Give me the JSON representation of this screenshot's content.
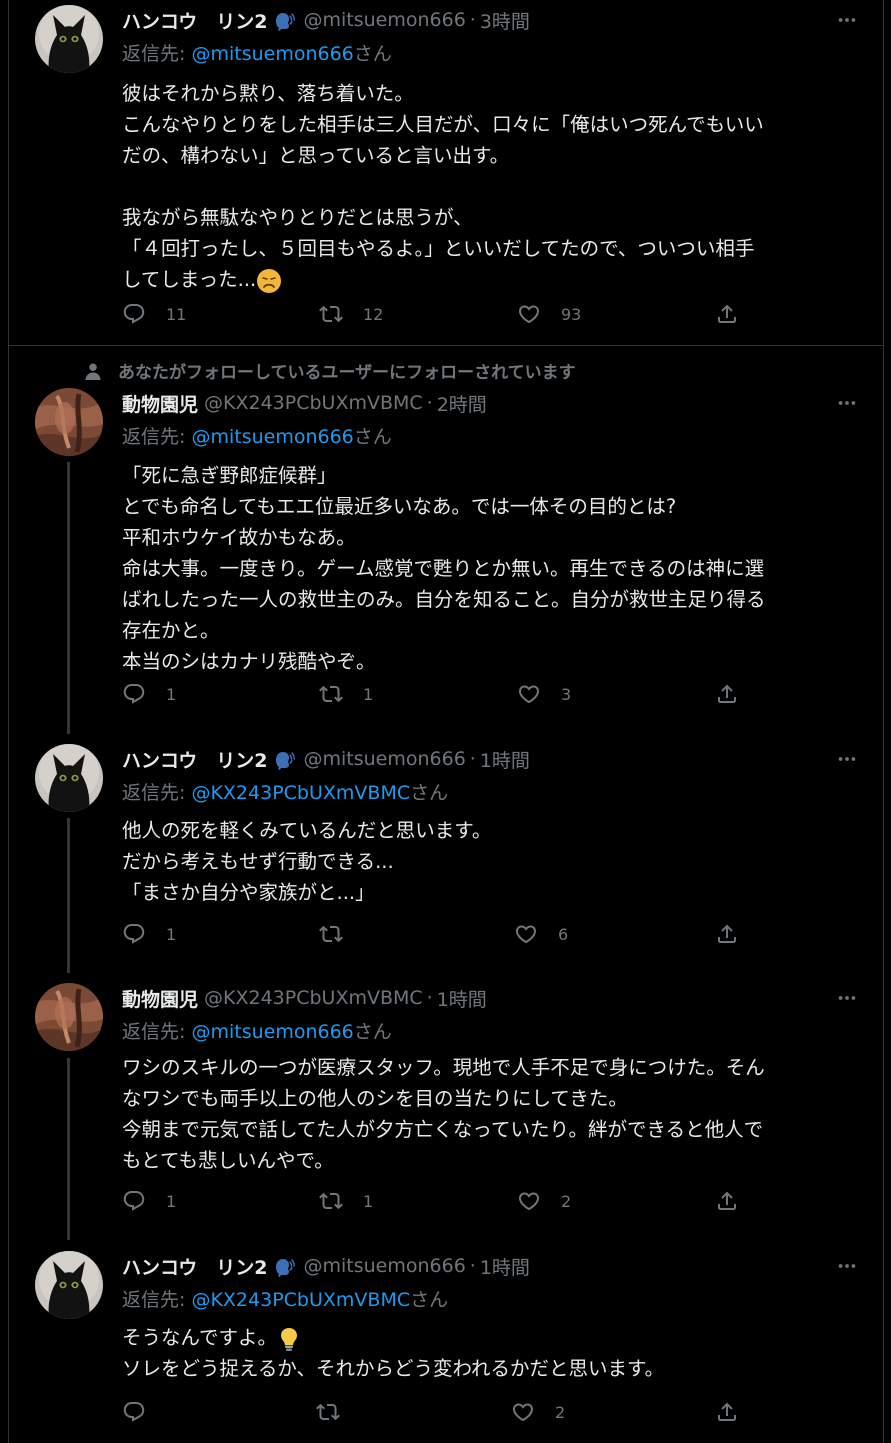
{
  "social_context": "あなたがフォローしているユーザーにフォローされています",
  "tweets": [
    {
      "name": "ハンコウ　リン2",
      "handle": "@mitsuemon666",
      "time": "3時間",
      "reply_prefix": "返信先: ",
      "reply_to": "@mitsuemon666",
      "reply_suffix": "さん",
      "lines": [
        "彼はそれから黙り、落ち着いた。",
        "こんなやりとりをした相手は三人目だが、口々に「俺はいつ死んでもいい",
        "だの、構わない」と思っていると言い出す。",
        "",
        "我ながら無駄なやりとりだとは思うが、",
        "「４回打ったし、５回目もやるよ。」といいだしてたので、ついつい相手",
        "してしまった..."
      ],
      "replies": "11",
      "retweets": "12",
      "likes": "93"
    },
    {
      "name": "動物園児",
      "handle": "@KX243PCbUXmVBMC",
      "time": "2時間",
      "reply_prefix": "返信先: ",
      "reply_to": "@mitsuemon666",
      "reply_suffix": "さん",
      "lines": [
        "「死に急ぎ野郎症候群」",
        "とでも命名してもエエ位最近多いなあ。では一体その目的とは?",
        "平和ホウケイ故かもなあ。",
        "命は大事。一度きり。ゲーム感覚で甦りとか無い。再生できるのは神に選",
        "ばれしたった一人の救世主のみ。自分を知ること。自分が救世主足り得る",
        "存在かと。",
        "本当のシはカナリ残酷やぞ。"
      ],
      "replies": "1",
      "retweets": "1",
      "likes": "3"
    },
    {
      "name": "ハンコウ　リン2",
      "handle": "@mitsuemon666",
      "time": "1時間",
      "reply_prefix": "返信先: ",
      "reply_to": "@KX243PCbUXmVBMC",
      "reply_suffix": "さん",
      "lines": [
        "他人の死を軽くみているんだと思います。",
        "だから考えもせず行動できる...",
        "「まさか自分や家族がと...」"
      ],
      "replies": "1",
      "retweets": "",
      "likes": "6"
    },
    {
      "name": "動物園児",
      "handle": "@KX243PCbUXmVBMC",
      "time": "1時間",
      "reply_prefix": "返信先: ",
      "reply_to": "@mitsuemon666",
      "reply_suffix": "さん",
      "lines": [
        "ワシのスキルの一つが医療スタッフ。現地で人手不足で身につけた。そん",
        "なワシでも両手以上の他人のシを目の当たりにしてきた。",
        "今朝まで元気で話してた人が夕方亡くなっていたり。絆ができると他人で",
        "もとても悲しいんやで。"
      ],
      "replies": "1",
      "retweets": "1",
      "likes": "2"
    },
    {
      "name": "ハンコウ　リン2",
      "handle": "@mitsuemon666",
      "time": "1時間",
      "reply_prefix": "返信先: ",
      "reply_to": "@KX243PCbUXmVBMC",
      "reply_suffix": "さん",
      "lines": [
        "そうなんですよ。",
        "ソレをどう捉えるか、それからどう変われるかだと思います。"
      ],
      "replies": "",
      "retweets": "",
      "likes": "2"
    }
  ]
}
